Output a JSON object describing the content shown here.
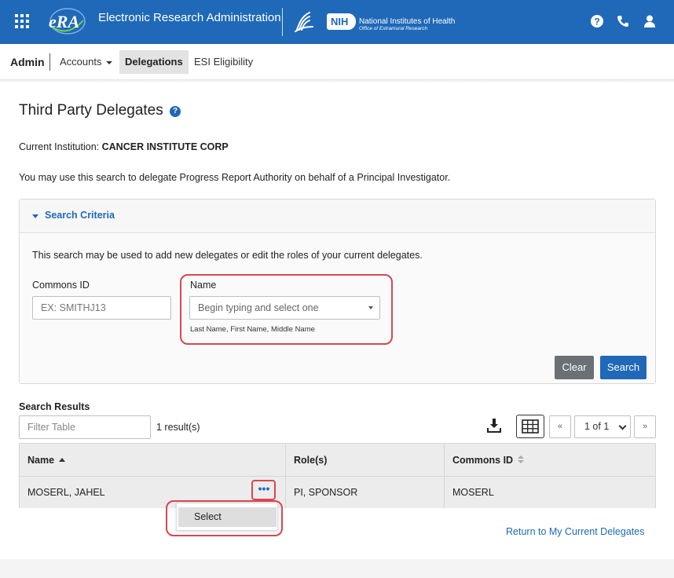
{
  "header": {
    "app_title": "Electronic Research Administration",
    "logo_text": "eRA",
    "nih_badge": "NIH",
    "nih_name": "National Institutes of Health",
    "nih_office": "Office of Extramural Research",
    "icons": [
      "grid-menu-icon",
      "hhs-eagle-icon",
      "help-icon",
      "phone-icon",
      "user-icon"
    ]
  },
  "nav": {
    "admin": "Admin",
    "items": [
      {
        "label": "Accounts"
      },
      {
        "label": "Delegations"
      },
      {
        "label": "ESI Eligibility"
      }
    ]
  },
  "page": {
    "title": "Third Party Delegates",
    "help_glyph": "?",
    "institution_label": "Current Institution:",
    "institution_value": "CANCER INSTITUTE CORP",
    "description": "You may use this search to delegate Progress Report Authority on behalf of a Principal Investigator."
  },
  "search": {
    "panel_title": "Search Criteria",
    "note": "This search may be used to add new delegates or edit the roles of your current delegates.",
    "commons_label": "Commons ID",
    "commons_placeholder": "EX: SMITHJ13",
    "name_label": "Name",
    "name_placeholder": "Begin typing and select one",
    "name_hint": "Last Name, First Name, Middle Name",
    "clear_label": "Clear",
    "search_label": "Search"
  },
  "results": {
    "title": "Search Results",
    "filter_placeholder": "Filter Table",
    "count": "1 result(s)",
    "pager_first": "«",
    "pager_page": "1 of 1",
    "pager_last": "»",
    "columns": [
      "Name",
      "Role(s)",
      "Commons ID"
    ],
    "rows": [
      {
        "name": "MOSERL, JAHEL",
        "roles": "PI, SPONSOR",
        "commons_id": "MOSERL"
      }
    ],
    "more_glyph": "•••",
    "menu_item": "Select",
    "return_link": "Return to My Current Delegates"
  },
  "colors": {
    "brand_blue": "#1f69b8",
    "highlight_red": "#d9464f",
    "clear_gray": "#6b7075"
  }
}
